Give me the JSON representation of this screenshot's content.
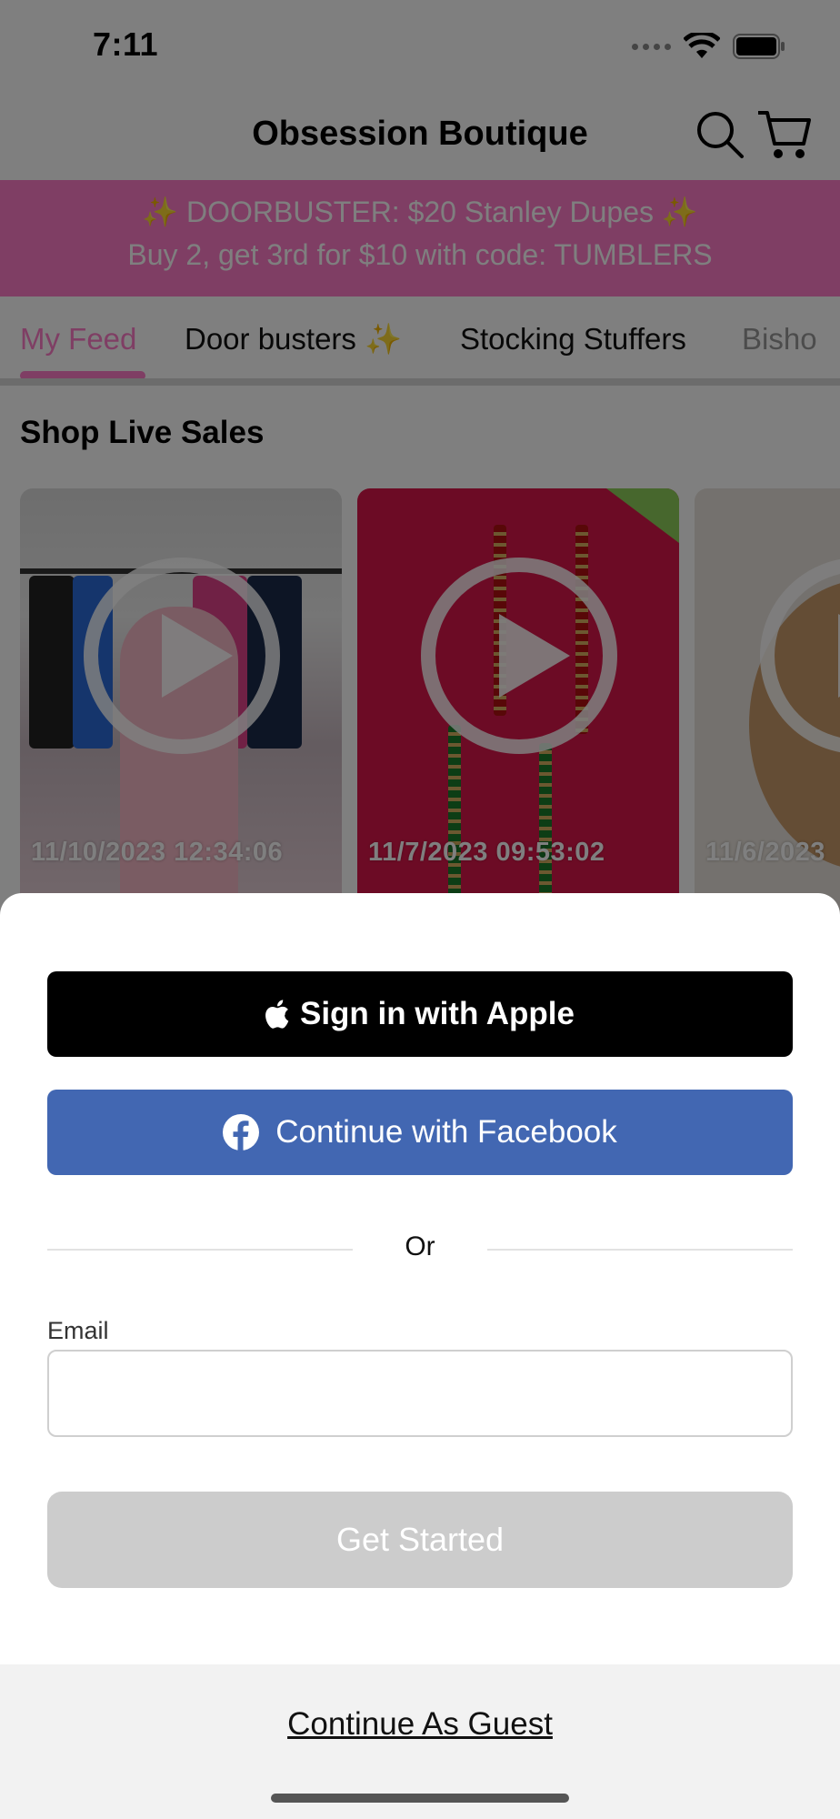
{
  "status_bar": {
    "time": "7:11"
  },
  "header": {
    "title": "Obsession Boutique"
  },
  "promo": {
    "line1": "DOORBUSTER: $20 Stanley Dupes",
    "sparkle": "✨",
    "line2": "Buy 2, get 3rd for $10 with code: TUMBLERS"
  },
  "tabs": [
    {
      "label": "My Feed",
      "active": true
    },
    {
      "label": "Door busters ✨",
      "active": false
    },
    {
      "label": "Stocking Stuffers",
      "active": false
    },
    {
      "label": "Bisho",
      "active": false
    }
  ],
  "section": {
    "title": "Shop Live Sales"
  },
  "cards": [
    {
      "date": "11/10/2023 12:34:06"
    },
    {
      "date": "11/7/2023 09:53:02"
    },
    {
      "date": "11/6/2023"
    }
  ],
  "sheet": {
    "apple_label": "Sign in with Apple",
    "facebook_label": "Continue with Facebook",
    "or_label": "Or",
    "email_label": "Email",
    "email_value": "",
    "email_placeholder": "",
    "get_started_label": "Get Started",
    "guest_label": "Continue As Guest"
  },
  "colors": {
    "accent_pink": "#ff7dc9",
    "facebook_blue": "#4267b2",
    "apple_black": "#000000",
    "disabled_gray": "#cccccc"
  },
  "icons": [
    "search-icon",
    "cart-icon",
    "apple-icon",
    "facebook-icon",
    "play-icon",
    "wifi-icon",
    "battery-icon",
    "signal-icon"
  ]
}
